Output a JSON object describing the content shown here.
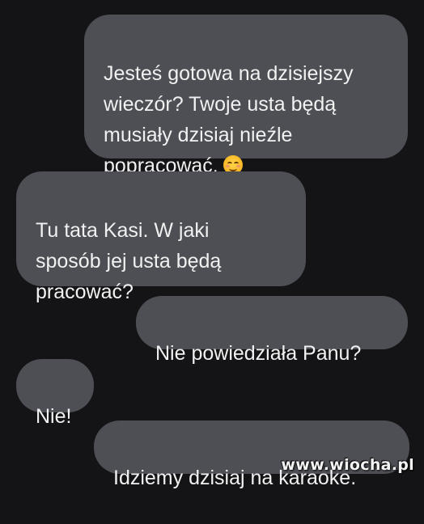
{
  "messages": [
    {
      "side": "outgoing",
      "text": "Jesteś gotowa na dzisiejszy\nwieczór? Twoje usta będą\nmusiały dzisiaj nieźle\npopracować.",
      "emoji": "smiling-face-icon"
    },
    {
      "side": "incoming",
      "text": "Tu tata Kasi. W jaki\nsposób jej usta będą\npracować?"
    },
    {
      "side": "outgoing",
      "text": "Nie powiedziała Panu?"
    },
    {
      "side": "incoming",
      "text": "Nie!"
    },
    {
      "side": "outgoing",
      "text": "Idziemy dzisiaj na karaoke."
    }
  ],
  "watermark": "www.wiocha.pl",
  "colors": {
    "background": "#141416",
    "bubble": "#4d4f54",
    "text": "#f1f1f1"
  }
}
